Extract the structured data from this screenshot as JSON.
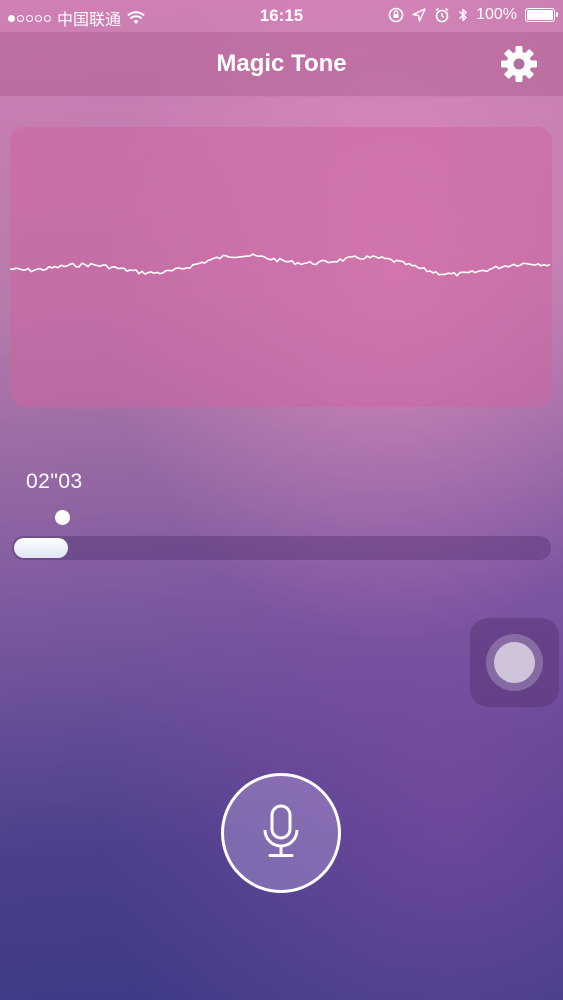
{
  "status_bar": {
    "carrier": "中国联通",
    "time": "16:15",
    "battery": "100%"
  },
  "nav": {
    "title": "Magic Tone"
  },
  "recording": {
    "elapsed": "02\"03",
    "progress": 0.1
  },
  "colors": {
    "accent_pink": "#d07fb4",
    "deep_purple": "#3a3a86"
  }
}
